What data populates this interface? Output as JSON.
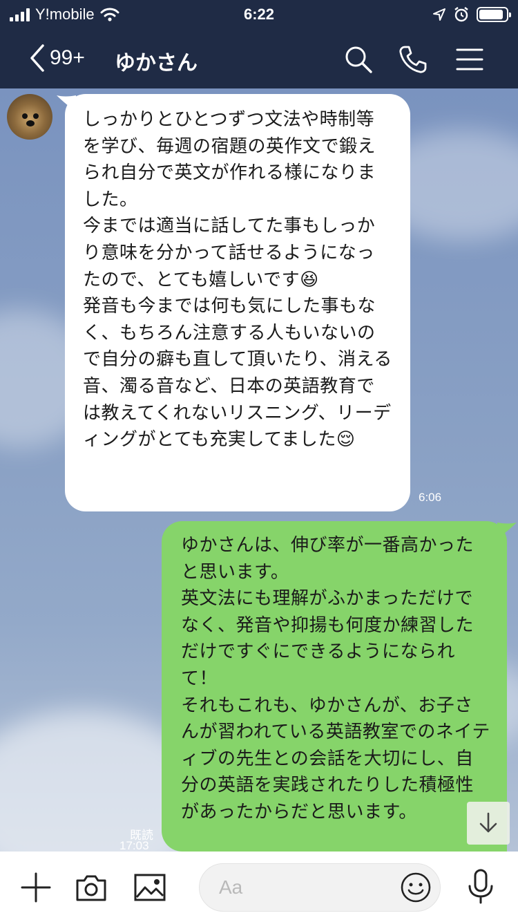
{
  "status_bar": {
    "carrier": "Y!mobile",
    "time": "6:22",
    "battery_level": 0.9
  },
  "nav": {
    "back_count": "99+",
    "title": "ゆかさん",
    "icons": [
      "search-icon",
      "phone-icon",
      "menu-icon"
    ]
  },
  "messages": {
    "incoming": {
      "text": "しっかりとひとつずつ文法や時制等を学び、毎週の宿題の英作文で鍛えられ自分で英文が作れる様になりました。\n今までは適当に話してた事もしっかり意味を分かって話せるようになったので、とても嬉しいです😆\n発音も今までは何も気にした事もなく、もちろん注意する人もいないので自分の癖も直して頂いたり、消える音、濁る音など、日本の英語教育では教えてくれないリスニング、リーディングがとても充実してました😌",
      "time": "6:06"
    },
    "outgoing": {
      "text": "ゆかさんは、伸び率が一番高かったと思います。\n英文法にも理解がふかまっただけでなく、発音や抑揚も何度か練習しただけですぐにできるようになられて！\nそれもこれも、ゆかさんが、お子さんが習われている英語教室でのネイティブの先生との会話を大切にし、自分の英語を実践されたりした積極性があったからだと思います。",
      "read_label": "既読",
      "time": "17:03"
    }
  },
  "input_bar": {
    "placeholder": "Aa",
    "icons": [
      "plus-icon",
      "camera-icon",
      "image-icon",
      "emoji-icon",
      "microphone-icon"
    ]
  },
  "colors": {
    "header_bg": "#1f2b45",
    "outgoing_bubble": "#86d46a",
    "incoming_bubble": "#ffffff"
  }
}
